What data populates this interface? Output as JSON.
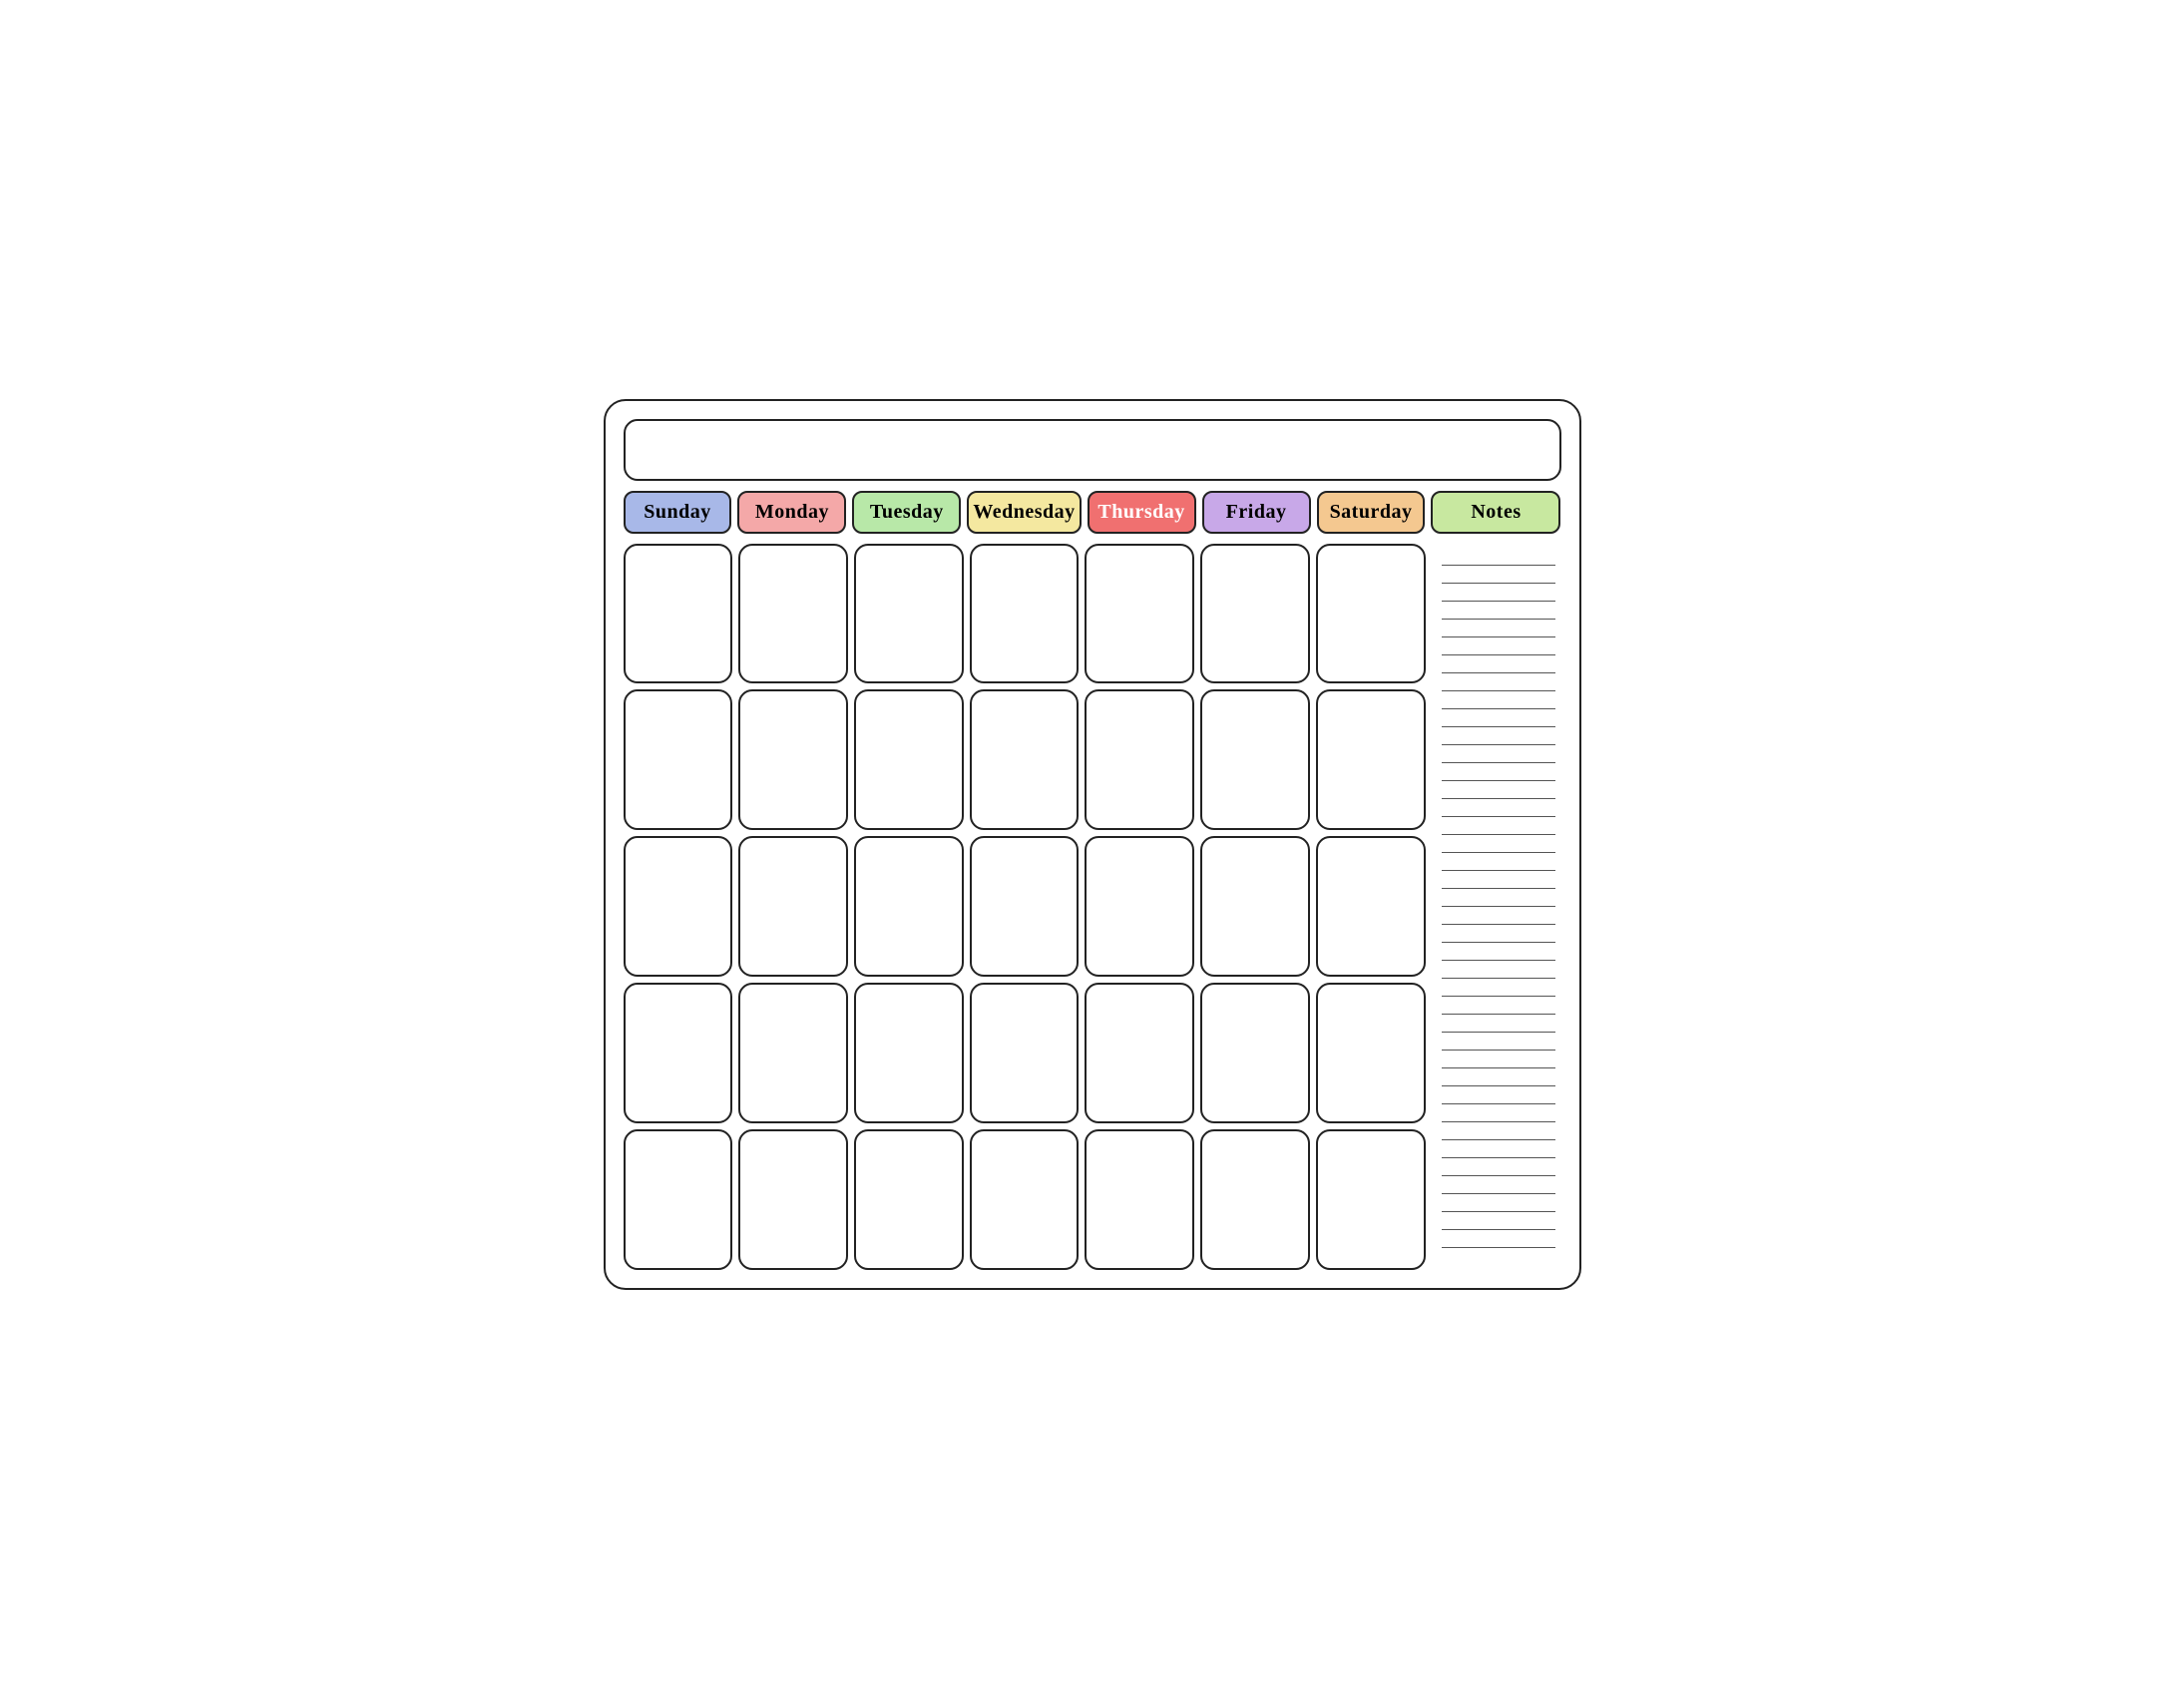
{
  "calendar": {
    "title": "",
    "days": [
      {
        "id": "sunday",
        "label": "Sunday",
        "class": "sunday"
      },
      {
        "id": "monday",
        "label": "Monday",
        "class": "monday"
      },
      {
        "id": "tuesday",
        "label": "Tuesday",
        "class": "tuesday"
      },
      {
        "id": "wednesday",
        "label": "Wednesday",
        "class": "wednesday"
      },
      {
        "id": "thursday",
        "label": "Thursday",
        "class": "thursday"
      },
      {
        "id": "friday",
        "label": "Friday",
        "class": "friday"
      },
      {
        "id": "saturday",
        "label": "Saturday",
        "class": "saturday"
      }
    ],
    "notes_label": "Notes",
    "notes_lines": 40,
    "rows": 5,
    "cols": 7
  }
}
